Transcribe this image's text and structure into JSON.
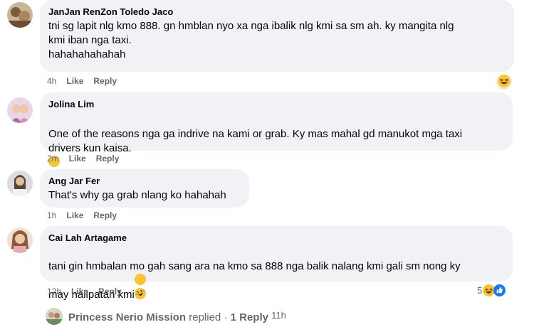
{
  "comments": [
    {
      "author": "JanJan RenZon Toledo Jaco",
      "text": "tni sg lapit nlg kmo 888. gn hmblan nyo xa nga ibalik nlg kmi sa sm ah. ky mangita nlg\nkmi iban nga taxi.\nhahahahahahah",
      "time": "4h",
      "like": "Like",
      "reply": "Reply",
      "reaction_icon": "laughing-emoji-icon"
    },
    {
      "author": "Jolina Lim",
      "text": "One of the reasons nga ga indrive na kami or grab. Ky mas mahal gd manukot mga taxi\ndrivers kun kaisa.",
      "inline_emoji": "grinning-emoji-icon",
      "time": "2m",
      "like": "Like",
      "reply": "Reply"
    },
    {
      "author": "Ang Jar Fer",
      "text": "That's why ga grab nlang ko hahahah",
      "time": "1h",
      "like": "Like",
      "reply": "Reply"
    },
    {
      "author": "Cai Lah Artagame",
      "text": "tani gin hmbalan mo gah sang ara na kmo sa 888 nga balik nalang kmi gali sm nong ky\nmay nalipatan kmi",
      "inline_emoji": "rolling-on-floor-laughing-emoji-icon",
      "time": "12h",
      "like": "Like",
      "reply": "Reply",
      "reaction_count": "5",
      "reaction_icons": [
        "laughing-emoji-icon",
        "like-icon"
      ]
    }
  ],
  "replies_summary": {
    "name": "Princess Nerio Mission",
    "action": "replied",
    "separator": "·",
    "count_label": "1 Reply",
    "time": "11h"
  },
  "colors": {
    "bubble": "#f0f2f5",
    "meta_text": "#65676b",
    "like_blue": "#1877f2",
    "emoji_yellow": "#f7c531"
  }
}
